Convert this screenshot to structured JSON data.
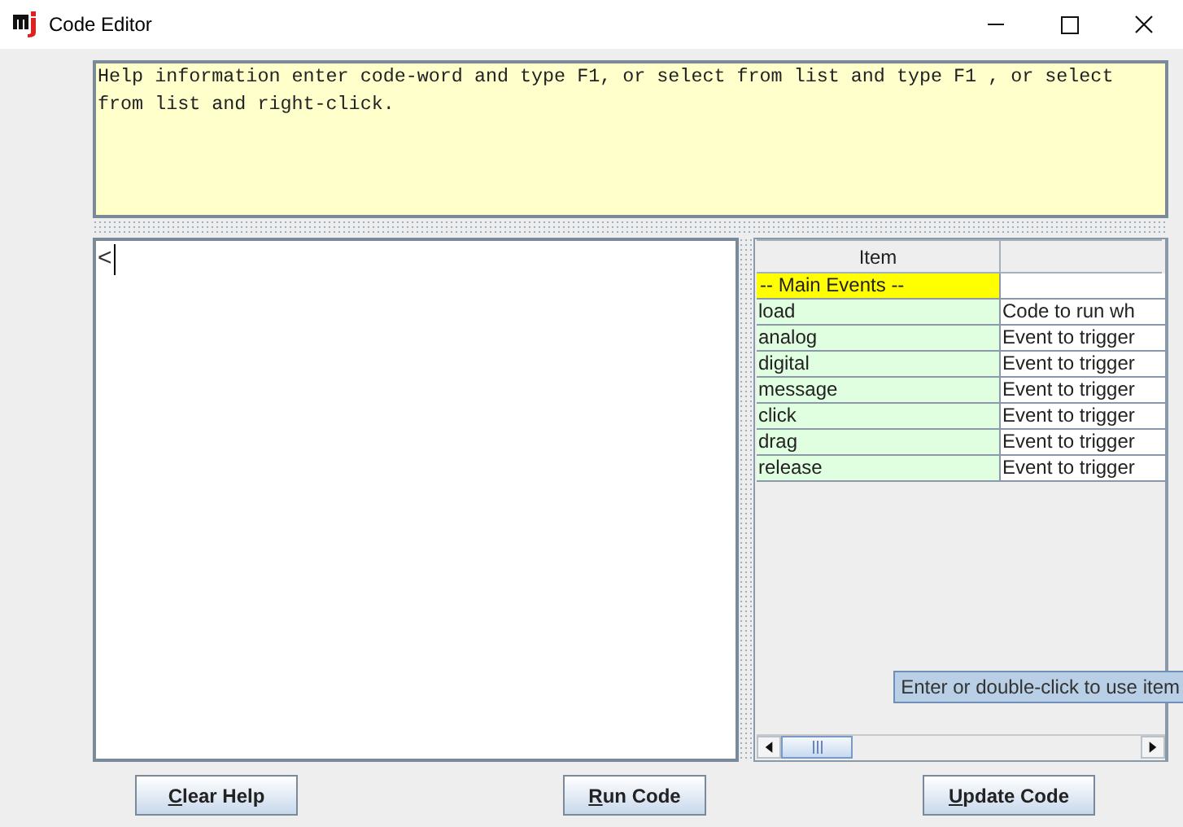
{
  "window": {
    "title": "Code Editor"
  },
  "help": {
    "text": "Help information enter code-word and type F1, or select from list and type F1 , or select from list and right-click."
  },
  "editor": {
    "value": "<"
  },
  "table": {
    "columns": [
      "Item"
    ],
    "rows": [
      {
        "kind": "heading",
        "item": "-- Main Events --",
        "selected": false
      },
      {
        "kind": "entry",
        "item": "load",
        "description": "Code to run wh",
        "selected": false
      },
      {
        "kind": "entry",
        "item": "analog",
        "description": "Event to trigger",
        "selected": false
      },
      {
        "kind": "entry",
        "item": "digital",
        "description": "Event to trigger",
        "selected": false
      },
      {
        "kind": "entry",
        "item": "message",
        "description": "Event to trigger",
        "selected": false
      },
      {
        "kind": "entry",
        "item": "click",
        "description": "Event to trigger",
        "selected": false
      },
      {
        "kind": "entry",
        "item": "drag",
        "description": "Event to trigger",
        "selected": false
      },
      {
        "kind": "entry",
        "item": "release",
        "description": "Event to trigger",
        "selected": false
      }
    ]
  },
  "tooltip": "Enter or double-click to use item",
  "buttons": [
    "Clear Help",
    "Run Code",
    "Update Code"
  ]
}
